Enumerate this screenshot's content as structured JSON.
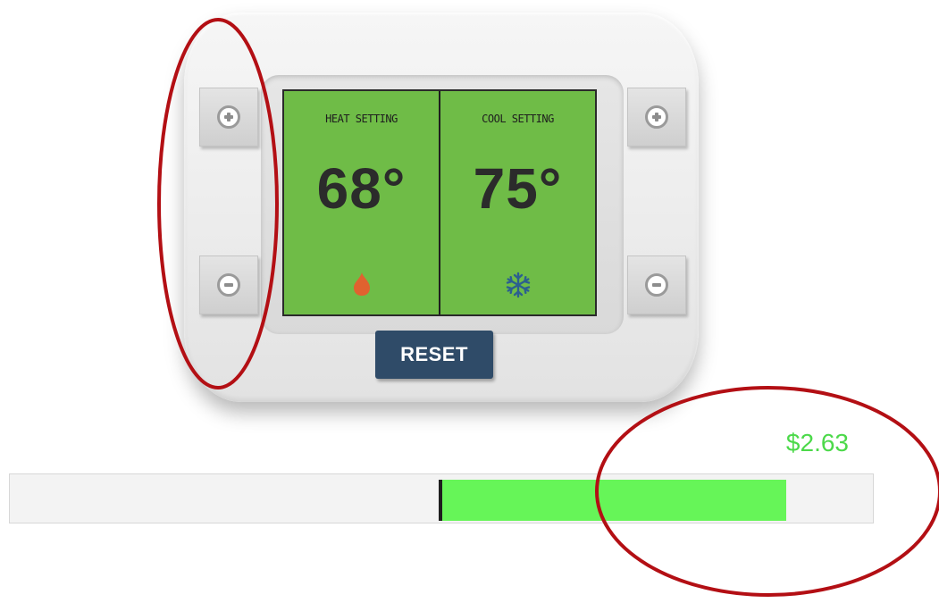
{
  "thermostat": {
    "heat": {
      "title": "HEAT SETTING",
      "temp": "68°",
      "icon": "flame-icon"
    },
    "cool": {
      "title": "COOL SETTING",
      "temp": "75°",
      "icon": "snowflake-icon"
    },
    "reset_label": "RESET",
    "increase_icon": "plus-icon",
    "decrease_icon": "minus-icon"
  },
  "cost": {
    "label": "$2.63",
    "bar_fill_fraction": 0.398
  },
  "colors": {
    "display": "#6fbc47",
    "reset": "#2f4b68",
    "flame": "#e0622f",
    "snowflake": "#2c5f8f",
    "cost_text": "#4cd94a",
    "bar_fill": "#66f558",
    "annotation": "#b30f14"
  }
}
